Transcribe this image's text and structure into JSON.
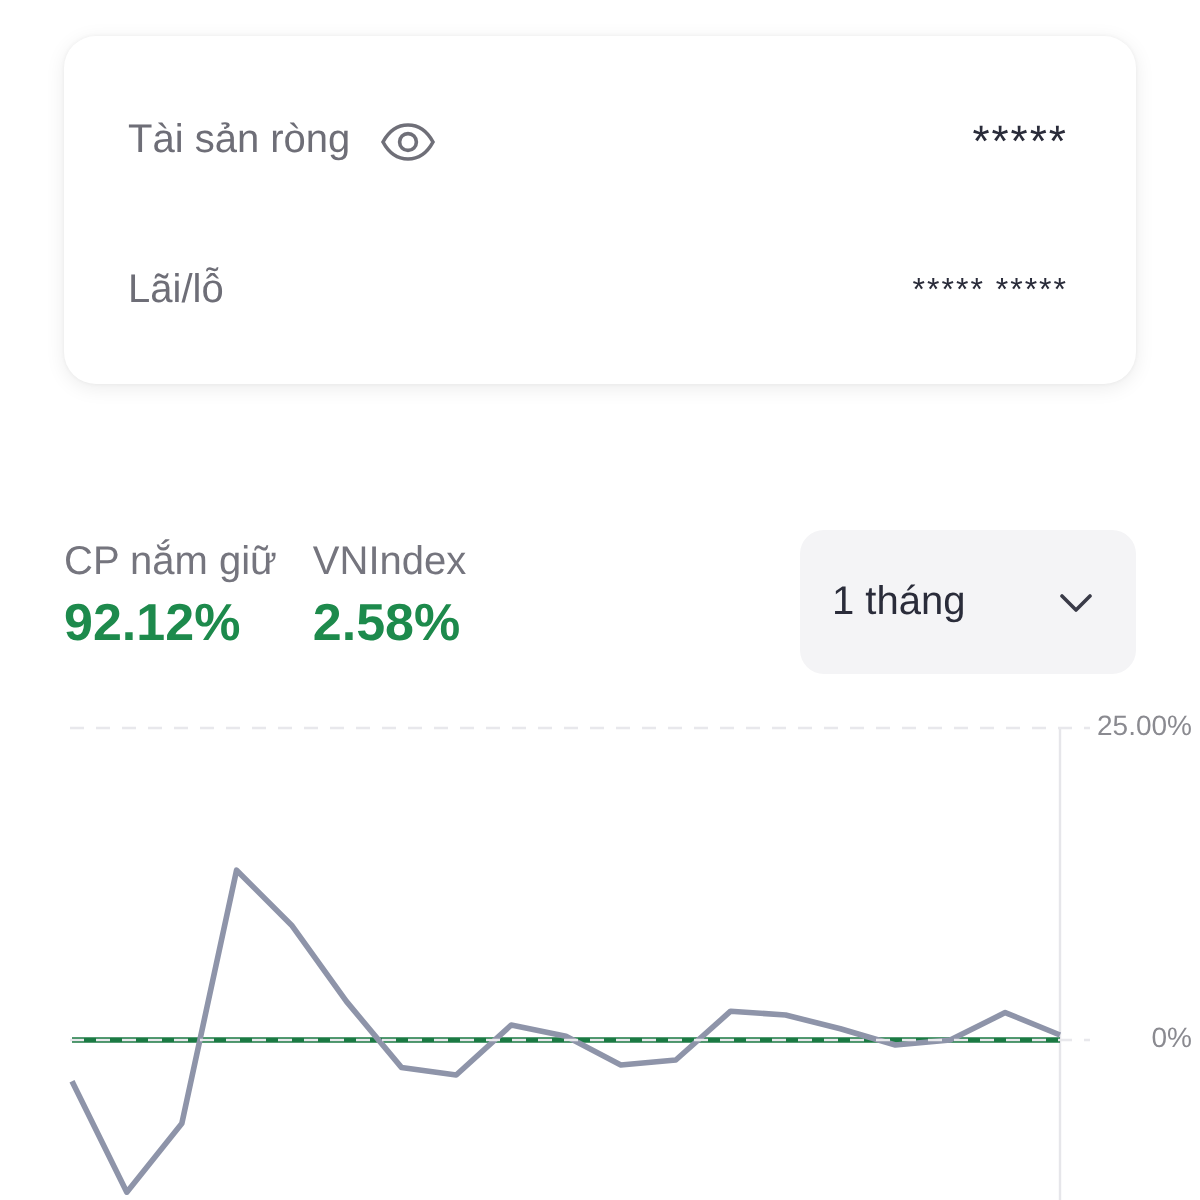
{
  "summary_card": {
    "rows": [
      {
        "label": "Tài sản ròng",
        "value": "*****",
        "kind": "main",
        "toggle": true
      },
      {
        "label": "Lãi/lỗ",
        "value": "***** *****",
        "kind": "sub",
        "toggle": false
      }
    ]
  },
  "performance": {
    "returns": [
      {
        "label": "CP nắm giữ",
        "value": "92.12%",
        "positive": true
      },
      {
        "label": "VNIndex",
        "value": "2.58%",
        "positive": true
      }
    ],
    "period_select": {
      "value": "1 tháng"
    }
  },
  "chart_data": {
    "type": "line",
    "series": [
      {
        "color": "#1b7a43",
        "values": [
          0,
          0,
          0,
          0,
          0,
          0,
          0,
          0,
          0,
          0,
          0,
          0,
          0,
          0,
          0,
          0,
          0,
          0,
          0
        ]
      },
      {
        "color": "#8e94a9",
        "values": [
          -3.3,
          -12.2,
          -6.7,
          13.6,
          9.2,
          3.1,
          -2.2,
          -2.8,
          1.2,
          0.3,
          -2.0,
          -1.6,
          2.3,
          2.0,
          0.9,
          -0.4,
          0.0,
          2.2,
          0.4
        ]
      }
    ],
    "ylim": [
      -12.5,
      25
    ],
    "yticks": [
      {
        "value": 25,
        "label": "25.00%"
      },
      {
        "value": 0,
        "label": "0%"
      }
    ]
  }
}
